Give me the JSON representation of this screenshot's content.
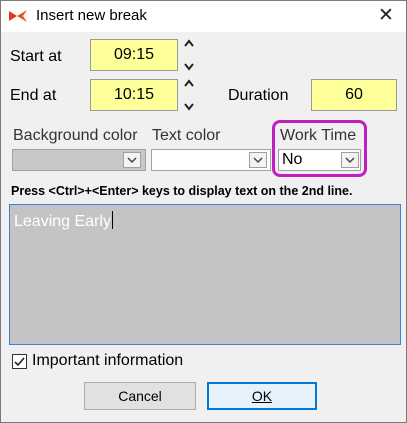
{
  "window": {
    "title": "Insert new break",
    "close_symbol": "✕",
    "icons": [
      "app-icon",
      "close-icon"
    ]
  },
  "timing": {
    "start_label": "Start at",
    "start_value": "09:15",
    "end_label": "End at",
    "end_value": "10:15",
    "duration_label": "Duration",
    "duration_value": "60"
  },
  "colors": {
    "background_label": "Background color",
    "background_value": "",
    "text_label": "Text color",
    "text_value": ""
  },
  "work_time": {
    "label": "Work Time",
    "value": "No",
    "highlight_color": "#c020c0"
  },
  "hint": "Press <Ctrl>+<Enter> keys to display text on the 2nd line.",
  "text_box": {
    "value": "Leaving Early"
  },
  "important": {
    "label": "Important information",
    "checked": true
  },
  "buttons": {
    "cancel": "Cancel",
    "ok": "OK"
  },
  "field_color": "#ffff99",
  "accent": "#0078d7"
}
